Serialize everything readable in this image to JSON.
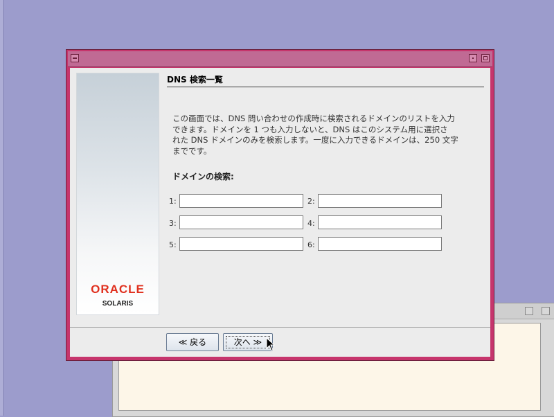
{
  "dialog": {
    "heading": "DNS 検索一覧",
    "description": "この画面では、DNS 問い合わせの作成時に検索されるドメインのリストを入力\nできます。ドメインを 1 つも入力しないと、DNS はこのシステム用に選択さ\nれた DNS ドメインのみを検索します。一度に入力できるドメインは、250 文字\nまでです。",
    "domains_label": "ドメインの検索:",
    "fields": [
      {
        "label": "1:",
        "value": ""
      },
      {
        "label": "2:",
        "value": ""
      },
      {
        "label": "3:",
        "value": ""
      },
      {
        "label": "4:",
        "value": ""
      },
      {
        "label": "5:",
        "value": ""
      },
      {
        "label": "6:",
        "value": ""
      }
    ],
    "back_button": "≪ 戻る",
    "next_button": "次へ ≫"
  },
  "branding": {
    "oracle": "ORACLE",
    "solaris": "SOLARIS",
    "oracle_color": "#e0301e"
  },
  "colors": {
    "desktop": "#9c9ccc",
    "window_frame": "#c6356c",
    "dialog_background": "#ececec"
  }
}
